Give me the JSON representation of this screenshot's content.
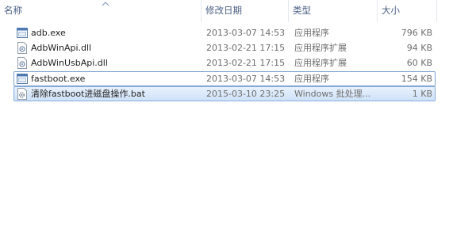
{
  "columns": {
    "name": "名称",
    "date": "修改日期",
    "type": "类型",
    "size": "大小"
  },
  "files": [
    {
      "name": "adb.exe",
      "date": "2013-03-07 14:53",
      "type": "应用程序",
      "size": "796 KB",
      "icon": "exe-icon"
    },
    {
      "name": "AdbWinApi.dll",
      "date": "2013-02-21 17:15",
      "type": "应用程序扩展",
      "size": "94 KB",
      "icon": "dll-icon"
    },
    {
      "name": "AdbWinUsbApi.dll",
      "date": "2013-02-21 17:15",
      "type": "应用程序扩展",
      "size": "60 KB",
      "icon": "dll-icon"
    },
    {
      "name": "fastboot.exe",
      "date": "2013-03-07 14:53",
      "type": "应用程序",
      "size": "154 KB",
      "icon": "exe-icon"
    },
    {
      "name": "清除fastboot进磁盘操作.bat",
      "date": "2015-03-10 23:25",
      "type": "Windows 批处理...",
      "size": "1 KB",
      "icon": "bat-icon"
    }
  ]
}
